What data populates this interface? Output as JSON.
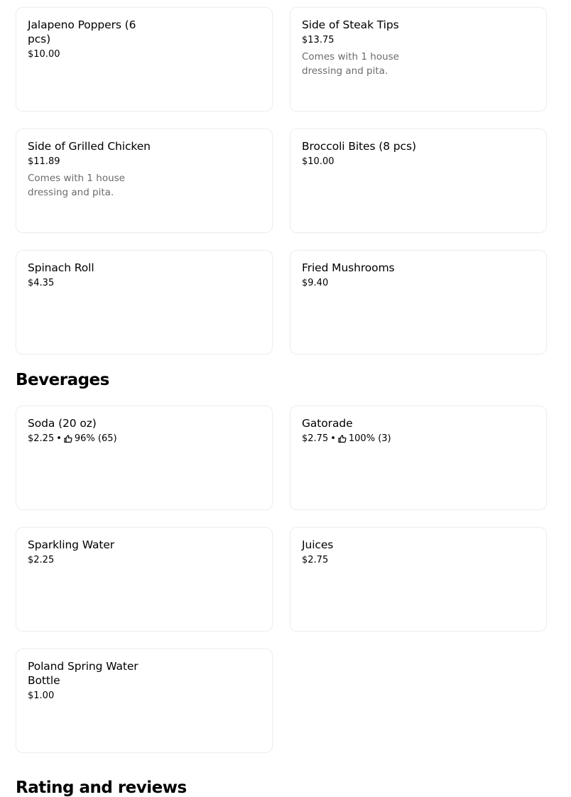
{
  "items_top": [
    {
      "name": "Jalapeno Poppers (6 pcs)",
      "price": "$10.00",
      "desc": ""
    },
    {
      "name": "Side of Steak Tips",
      "price": "$13.75",
      "desc": "Comes with 1 house dressing and pita."
    },
    {
      "name": "Side of Grilled Chicken",
      "price": "$11.89",
      "desc": "Comes with 1 house dressing and pita."
    },
    {
      "name": "Broccoli Bites (8 pcs)",
      "price": "$10.00",
      "desc": ""
    },
    {
      "name": "Spinach Roll",
      "price": "$4.35",
      "desc": ""
    },
    {
      "name": "Fried Mushrooms",
      "price": "$9.40",
      "desc": ""
    }
  ],
  "beverages": {
    "title": "Beverages",
    "items": [
      {
        "name": "Soda (20 oz)",
        "price": "$2.25",
        "separator": "•",
        "rating": "96% (65)"
      },
      {
        "name": "Gatorade",
        "price": "$2.75",
        "separator": "•",
        "rating": "100% (3)"
      },
      {
        "name": "Sparkling Water",
        "price": "$2.25"
      },
      {
        "name": "Juices",
        "price": "$2.75"
      },
      {
        "name": "Poland Spring Water Bottle",
        "price": "$1.00"
      }
    ]
  },
  "reviews": {
    "title": "Rating and reviews"
  },
  "icons": {
    "rating": "thumbs-up-icon"
  }
}
